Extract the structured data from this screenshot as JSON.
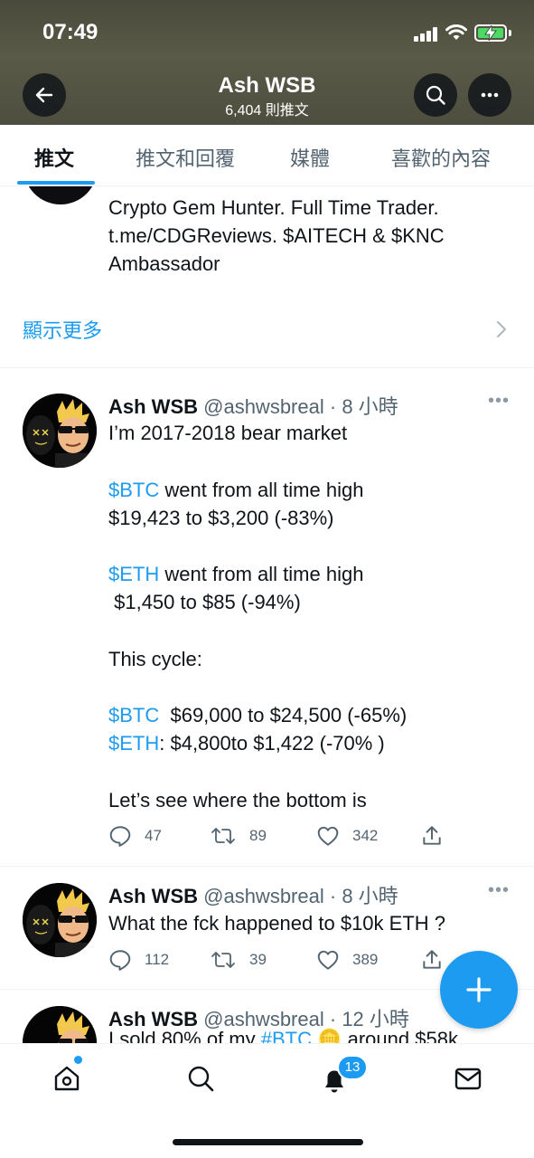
{
  "status_bar": {
    "time": "07:49"
  },
  "header": {
    "name": "Ash WSB",
    "tweet_count": "6,404 則推文"
  },
  "tabs": [
    {
      "label": "推文",
      "active": true
    },
    {
      "label": "推文和回覆",
      "active": false
    },
    {
      "label": "媒體",
      "active": false
    },
    {
      "label": "喜歡的內容",
      "active": false
    }
  ],
  "bio": {
    "lines": [
      "Crypto Gem Hunter. Full Time Trader.",
      "t.me/CDGReviews. $AITECH & $KNC",
      "Ambassador"
    ],
    "show_more": "顯示更多"
  },
  "tweets": [
    {
      "name": "Ash WSB",
      "handle": "@ashwsbreal",
      "time": "· 8 小時",
      "lines": [
        {
          "text": "I’m 2017-2018 bear market"
        },
        {
          "text": ""
        },
        {
          "tag": "$BTC",
          "text": " went from all time high"
        },
        {
          "text": "$19,423 to $3,200 (-83%)"
        },
        {
          "text": ""
        },
        {
          "tag": "$ETH",
          "text": " went from all time high"
        },
        {
          "text": " $1,450 to $85 (-94%)"
        },
        {
          "text": ""
        },
        {
          "text": "This cycle:"
        },
        {
          "text": ""
        },
        {
          "tag": "$BTC",
          "text": "  $69,000 to $24,500 (-65%)"
        },
        {
          "tag": "$ETH",
          "text": ": $4,800to $1,422 (-70% )"
        },
        {
          "text": ""
        },
        {
          "text": "Let’s see where the bottom is"
        }
      ],
      "replies": "47",
      "retweets": "89",
      "likes": "342"
    },
    {
      "name": "Ash WSB",
      "handle": "@ashwsbreal",
      "time": "· 8 小時",
      "lines": [
        {
          "text": "What the fck happened to $10k ETH ?"
        }
      ],
      "replies": "112",
      "retweets": "39",
      "likes": "389"
    },
    {
      "name": "Ash WSB",
      "handle": "@ashwsbreal",
      "time": "· 12 小時",
      "partial_text_prefix": "I sold 80% of my ",
      "partial_tag": "#BTC",
      "partial_text_suffix": " 🪙 around $58k"
    }
  ],
  "bottom_nav": {
    "notifications_badge": "13"
  },
  "colors": {
    "accent": "#1d9bf0",
    "text": "#0f1419",
    "secondary": "#536471"
  }
}
